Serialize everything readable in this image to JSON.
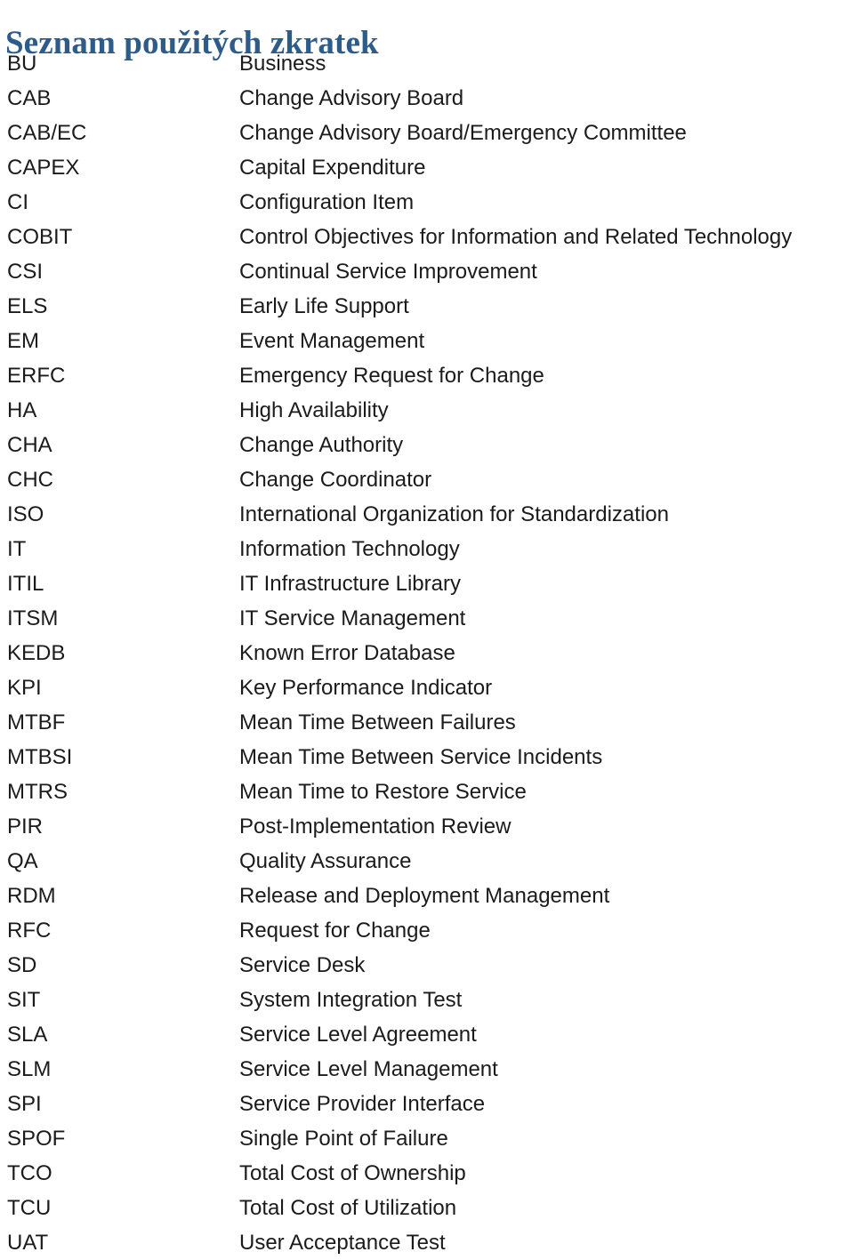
{
  "document": {
    "title": "Seznam použitých zkratek",
    "title_color": "#2e5c8a",
    "text_color": "#1b1b1b",
    "background_color": "#ffffff"
  },
  "abbreviations": [
    {
      "term": "BU",
      "definition": "Business"
    },
    {
      "term": "CAB",
      "definition": "Change Advisory Board"
    },
    {
      "term": "CAB/EC",
      "definition": "Change Advisory Board/Emergency Committee"
    },
    {
      "term": "CAPEX",
      "definition": "Capital Expenditure"
    },
    {
      "term": "CI",
      "definition": "Configuration Item"
    },
    {
      "term": "COBIT",
      "definition": "Control Objectives for Information and Related Technology"
    },
    {
      "term": "CSI",
      "definition": "Continual Service Improvement"
    },
    {
      "term": "ELS",
      "definition": "Early Life Support"
    },
    {
      "term": "EM",
      "definition": "Event Management"
    },
    {
      "term": "ERFC",
      "definition": "Emergency Request for Change"
    },
    {
      "term": "HA",
      "definition": "High Availability"
    },
    {
      "term": "CHA",
      "definition": "Change Authority"
    },
    {
      "term": "CHC",
      "definition": "Change Coordinator"
    },
    {
      "term": "ISO",
      "definition": "International Organization for Standardization"
    },
    {
      "term": "IT",
      "definition": "Information Technology"
    },
    {
      "term": "ITIL",
      "definition": "IT Infrastructure Library"
    },
    {
      "term": "ITSM",
      "definition": "IT Service Management"
    },
    {
      "term": "KEDB",
      "definition": "Known Error Database"
    },
    {
      "term": "KPI",
      "definition": "Key Performance Indicator"
    },
    {
      "term": "MTBF",
      "definition": "Mean Time Between Failures"
    },
    {
      "term": "MTBSI",
      "definition": "Mean Time Between Service Incidents"
    },
    {
      "term": "MTRS",
      "definition": "Mean Time to Restore Service"
    },
    {
      "term": "PIR",
      "definition": "Post-Implementation Review"
    },
    {
      "term": "QA",
      "definition": "Quality Assurance"
    },
    {
      "term": "RDM",
      "definition": "Release and Deployment Management"
    },
    {
      "term": "RFC",
      "definition": "Request for Change"
    },
    {
      "term": "SD",
      "definition": "Service Desk"
    },
    {
      "term": "SIT",
      "definition": "System Integration Test"
    },
    {
      "term": "SLA",
      "definition": "Service Level Agreement"
    },
    {
      "term": "SLM",
      "definition": "Service Level Management"
    },
    {
      "term": "SPI",
      "definition": "Service Provider Interface"
    },
    {
      "term": "SPOF",
      "definition": "Single Point of Failure"
    },
    {
      "term": "TCO",
      "definition": "Total Cost of Ownership"
    },
    {
      "term": "TCU",
      "definition": "Total Cost of Utilization"
    },
    {
      "term": "UAT",
      "definition": "User Acceptance Test"
    }
  ]
}
